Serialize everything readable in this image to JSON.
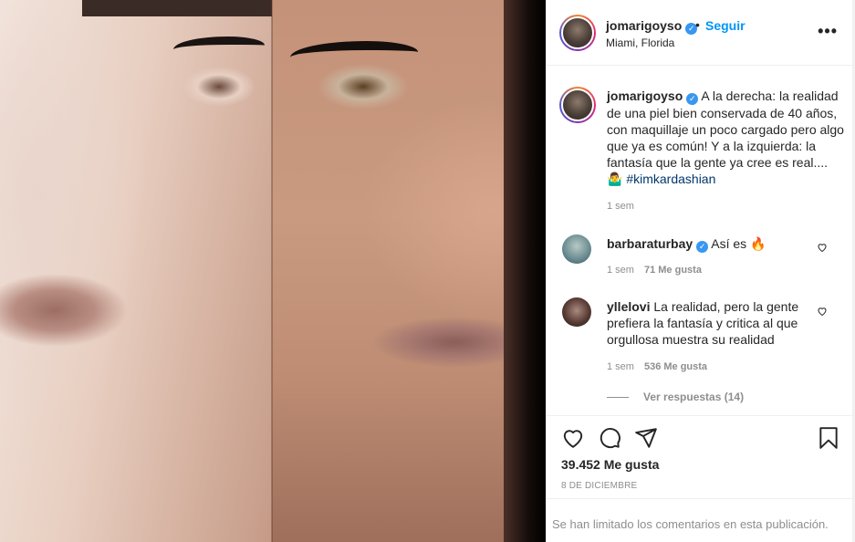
{
  "post": {
    "username": "jomarigoyso",
    "follow_label": "Seguir",
    "location": "Miami, Florida",
    "more_label": "•••",
    "caption_text": "A la derecha: la realidad de una piel bien conservada de 40 años, con maquillaje un poco cargado pero algo que ya es común! Y a la izquierda: la fantasía que la gente ya cree es real.... 🤷‍♂️ ",
    "caption_hashtag": "#kimkardashian",
    "caption_time": "1 sem",
    "likes": "39.452 Me gusta",
    "date": "8 DE DICIEMBRE",
    "limited_comments": "Se han limitado los comentarios en esta publicación."
  },
  "comments": [
    {
      "username": "barbaraturbay",
      "verified": true,
      "text": "Así es 🔥",
      "time": "1 sem",
      "likes": "71 Me gusta"
    },
    {
      "username": "yllelovi",
      "verified": false,
      "text": "La realidad, pero la gente prefiera la fantasía y critica al que orgullosa muestra su realidad",
      "time": "1 sem",
      "likes": "536 Me gusta"
    }
  ],
  "replies_label": "Ver respuestas (14)",
  "colors": {
    "link_blue": "#0095f6",
    "verified_blue": "#3897f0",
    "hashtag": "#00376b",
    "muted": "#8e8e8e"
  },
  "icons": [
    "verified-icon",
    "more-icon",
    "heart-icon",
    "comment-icon",
    "share-icon",
    "bookmark-icon"
  ]
}
